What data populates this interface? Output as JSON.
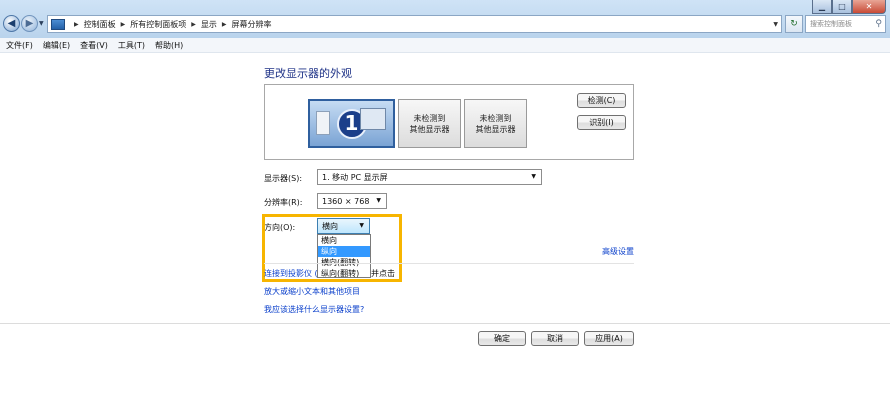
{
  "address": {
    "breadcrumbs": [
      "控制面板",
      "所有控制面板项",
      "显示",
      "屏幕分辨率"
    ],
    "search_placeholder": "搜索控制面板"
  },
  "menu": [
    "文件(F)",
    "编辑(E)",
    "查看(V)",
    "工具(T)",
    "帮助(H)"
  ],
  "title": "更改显示器的外观",
  "monitors": [
    {
      "number": "1"
    },
    {
      "label_line1": "未检测到",
      "label_line2": "其他显示器"
    },
    {
      "label_line1": "未检测到",
      "label_line2": "其他显示器"
    }
  ],
  "buttons": {
    "detect": "检测(C)",
    "identify": "识别(I)",
    "ok": "确定",
    "cancel": "取消",
    "apply": "应用(A)"
  },
  "fields": {
    "display_label": "显示器(S):",
    "display_value": "1. 移动 PC 显示屏",
    "resolution_label": "分辨率(R):",
    "resolution_value": "1360 × 768",
    "orientation_label": "方向(O):",
    "orientation_value": "横向",
    "orientation_options": [
      "横向",
      "纵向",
      "横向(翻转)",
      "纵向(翻转)"
    ],
    "orientation_highlighted": "纵向"
  },
  "links": {
    "advanced": "高级设置",
    "projector": "连接到投影仪 (",
    "projector_tail": "并点击 ",
    "enlarge": "放大或缩小文本和其他项目",
    "which": "我应该选择什么显示器设置?"
  },
  "colors": {
    "highlight_border": "#f7b500",
    "link": "#0a3fcb",
    "selected_option": "#3399ff"
  }
}
